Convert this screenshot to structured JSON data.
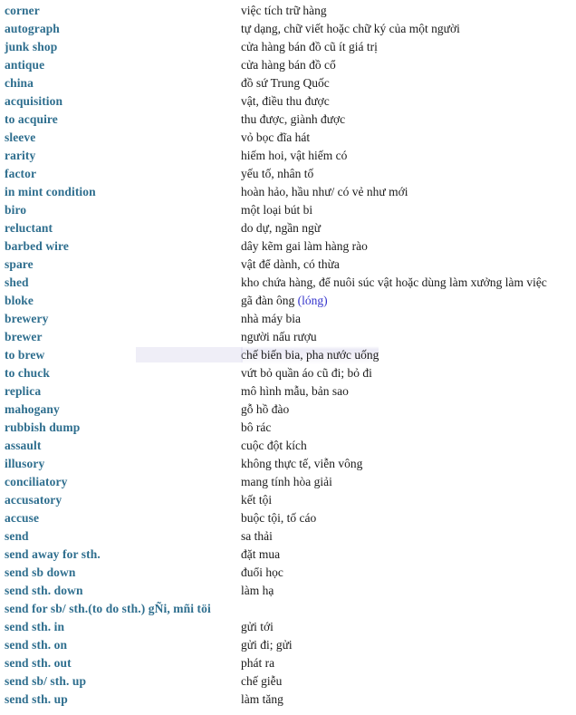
{
  "page": {
    "type": "vocabulary-glossary",
    "source_language": "English",
    "target_language": "Vietnamese",
    "background_color": "#ffffff",
    "term_color": "#2e6e8e",
    "definition_color": "#1a1a1a",
    "slang_tag_color": "#3333cc"
  },
  "entries": [
    {
      "term": "corner",
      "definition": "việc tích trữ hàng"
    },
    {
      "term": "autograph",
      "definition": "tự dạng, chữ viết hoặc chữ ký của một người"
    },
    {
      "term": "junk shop",
      "definition": "cửa hàng bán đồ cũ ít giá trị"
    },
    {
      "term": "antique",
      "definition": "cửa hàng bán đồ cổ"
    },
    {
      "term": "china",
      "definition": "đồ sứ Trung Quốc"
    },
    {
      "term": "acquisition",
      "definition": "vật, điều thu được"
    },
    {
      "term": "to acquire",
      "definition": "thu được, giành được"
    },
    {
      "term": "sleeve",
      "definition": "vỏ bọc đĩa hát"
    },
    {
      "term": "rarity",
      "definition": "hiếm hoi, vật hiếm có"
    },
    {
      "term": "factor",
      "definition": "yếu tố, nhân tố"
    },
    {
      "term": "in mint condition",
      "definition": "hoàn hảo, hầu như/ có vẻ như mới"
    },
    {
      "term": "biro",
      "definition": "một loại bút bi"
    },
    {
      "term": "reluctant",
      "definition": "do dự, ngần ngừ"
    },
    {
      "term": "barbed wire",
      "definition": "dây kẽm gai làm hàng rào"
    },
    {
      "term": "spare",
      "definition": "vật để dành, có thừa"
    },
    {
      "term": "shed",
      "definition": "kho chứa hàng, để nuôi súc vật hoặc dùng làm xưởng làm việc"
    },
    {
      "term": "bloke",
      "definition": "gã đàn ông ",
      "slang_tag": "(lóng)"
    },
    {
      "term": "brewery",
      "definition": "nhà máy bia"
    },
    {
      "term": "brewer",
      "definition": "người nấu rượu"
    },
    {
      "term": "to brew",
      "definition": "chế biến bia, pha nước uống",
      "selected": true
    },
    {
      "term": "to chuck",
      "definition": "vứt bỏ quần áo cũ đi; bỏ đi"
    },
    {
      "term": "replica",
      "definition": "mô hình mẫu, bản sao"
    },
    {
      "term": "mahogany",
      "definition": "gỗ hồ đào"
    },
    {
      "term": "rubbish dump",
      "definition": "bô rác"
    },
    {
      "term": "assault",
      "definition": "cuộc đột kích"
    },
    {
      "term": "illusory",
      "definition": "không thực tế, viễn vông"
    },
    {
      "term": "conciliatory",
      "definition": "mang tính hòa giải"
    },
    {
      "term": "accusatory",
      "definition": "kết tội"
    },
    {
      "term": "accuse",
      "definition": "buộc tội, tố cáo"
    },
    {
      "term": "send",
      "definition": "sa thải"
    },
    {
      "term": "send away for sth.",
      "definition": "đặt mua"
    },
    {
      "term": "send sb down",
      "definition": "đuổi học"
    },
    {
      "term": "send sth. down",
      "definition": "làm hạ"
    },
    {
      "term": "send for sb/ sth.(to do sth.) gÑi, mñi töi",
      "definition": ""
    },
    {
      "term": "send sth. in",
      "definition": "gửi tới"
    },
    {
      "term": "send sth. on",
      "definition": "gửi đi; gửi"
    },
    {
      "term": "send sth. out",
      "definition": "phát ra"
    },
    {
      "term": "send sb/ sth. up",
      "definition": "chế giễu"
    },
    {
      "term": "send sth. up",
      "definition": "làm tăng"
    }
  ]
}
